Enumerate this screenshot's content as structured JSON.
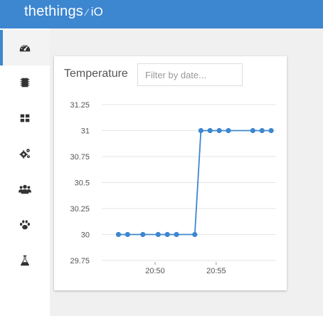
{
  "header": {
    "logo_main": "thethings",
    "logo_suffix": "iO",
    "bg_color": "#3d86d0"
  },
  "sidebar": {
    "items": [
      {
        "icon": "dashboard-gauge-icon",
        "active": true
      },
      {
        "icon": "chip-icon",
        "active": false
      },
      {
        "icon": "grid-icon",
        "active": false
      },
      {
        "icon": "gears-icon",
        "active": false
      },
      {
        "icon": "users-icon",
        "active": false
      },
      {
        "icon": "paw-icon",
        "active": false
      },
      {
        "icon": "flask-icon",
        "active": false
      }
    ]
  },
  "widget": {
    "title": "Temperature",
    "filter_placeholder": "Filter by date..."
  },
  "chart_data": {
    "type": "line",
    "title": "",
    "xlabel": "",
    "ylabel": "",
    "series": [
      {
        "color": "#3d86d0",
        "x": [
          "20:47",
          "20:47:45",
          "20:49",
          "20:50:15",
          "20:51",
          "20:51:45",
          "20:53:15",
          "20:53:45",
          "20:54:30",
          "20:55:15",
          "20:56",
          "20:58",
          "20:58:45",
          "20:59:30"
        ],
        "y": [
          30,
          30,
          30,
          30,
          30,
          30,
          30,
          31,
          31,
          31,
          31,
          31,
          31,
          31
        ]
      }
    ],
    "x_ticks": [
      "20:50",
      "20:55"
    ],
    "y_ticks": [
      "31.25",
      "31",
      "30.75",
      "30.5",
      "30.25",
      "30",
      "29.75"
    ],
    "ylim": [
      29.75,
      31.25
    ],
    "grid": true
  }
}
